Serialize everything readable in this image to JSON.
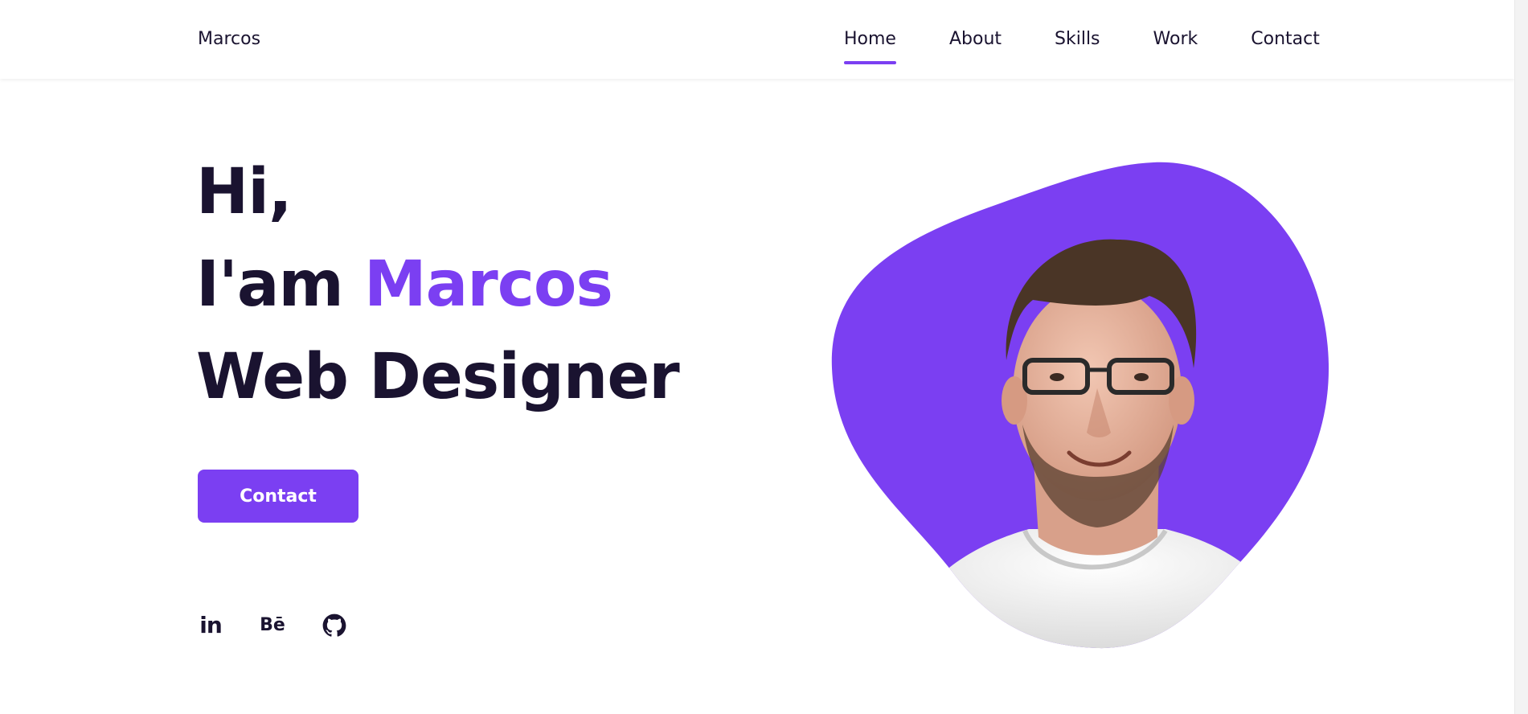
{
  "header": {
    "brand": "Marcos",
    "nav": [
      {
        "label": "Home",
        "active": true
      },
      {
        "label": "About",
        "active": false
      },
      {
        "label": "Skills",
        "active": false
      },
      {
        "label": "Work",
        "active": false
      },
      {
        "label": "Contact",
        "active": false
      }
    ]
  },
  "hero": {
    "greeting": "Hi,",
    "intro_prefix": "I'am ",
    "name": "Marcos",
    "role": "Web Designer",
    "cta_label": "Contact"
  },
  "socials": [
    {
      "name": "linkedin-icon",
      "glyph": "in"
    },
    {
      "name": "behance-icon",
      "glyph": "Bē"
    },
    {
      "name": "github-icon",
      "glyph": ""
    }
  ],
  "colors": {
    "accent": "#7b3ff2",
    "text": "#1a1330",
    "background": "#ffffff"
  }
}
